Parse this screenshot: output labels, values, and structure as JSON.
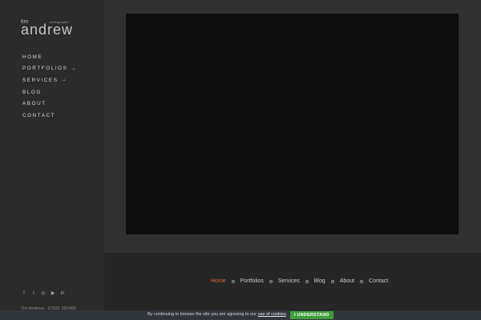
{
  "logo": {
    "top": "tim",
    "tagline": "photographer",
    "main": "andrew"
  },
  "sidebar_nav": [
    {
      "label": "HOME",
      "arrow": ""
    },
    {
      "label": "PORTFOLIOS",
      "arrow": "→"
    },
    {
      "label": "SERVICES",
      "arrow": "→"
    },
    {
      "label": "BLOG",
      "arrow": ""
    },
    {
      "label": "ABOUT",
      "arrow": ""
    },
    {
      "label": "CONTACT",
      "arrow": ""
    }
  ],
  "social": {
    "facebook": "f",
    "twitter": "t",
    "instagram": "◎",
    "youtube": "▶",
    "linkedin": "in"
  },
  "sidebar_contact": "Tim Andrew - 07831 391455",
  "footer_nav": [
    {
      "label": "Home",
      "active": true
    },
    {
      "label": "Portfolios",
      "active": false
    },
    {
      "label": "Services",
      "active": false
    },
    {
      "label": "Blog",
      "active": false
    },
    {
      "label": "About",
      "active": false
    },
    {
      "label": "Contact",
      "active": false
    }
  ],
  "cookie": {
    "text": "By continuing to browse the site you are agreeing to our ",
    "link": "use of cookies",
    "end": ".",
    "button": "I UNDERSTAND"
  },
  "colors": {
    "accent": "#e0642c",
    "button": "#3f9e3e"
  }
}
